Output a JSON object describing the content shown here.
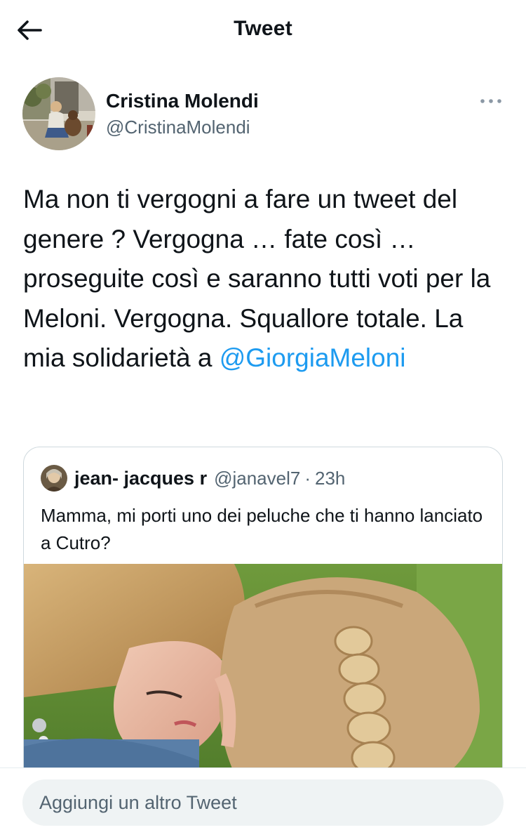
{
  "header": {
    "title": "Tweet",
    "back_icon": "arrow-left-icon"
  },
  "tweet": {
    "author": {
      "name": "Cristina Molendi",
      "handle": "@CristinaMolendi"
    },
    "more_icon": "more-horizontal-icon",
    "text": "Ma non ti vergogni a fare un tweet del genere ? Vergogna … fate così … proseguite così e saranno tutti voti per la Meloni. Vergogna. Squallore totale. La mia solidarietà a",
    "mention": "@GiorgiaMeloni",
    "colors": {
      "accent": "#1d9bf0",
      "text": "#0f1419",
      "secondary": "#536471"
    }
  },
  "quoted_tweet": {
    "author": {
      "name": "jean- jacques r",
      "handle": "@janavel7"
    },
    "separator": "·",
    "time": "23h",
    "text": "Mamma, mi porti uno dei peluche che ti hanno lanciato a Cutro?"
  },
  "reply": {
    "placeholder": "Aggiungi un altro Tweet"
  }
}
